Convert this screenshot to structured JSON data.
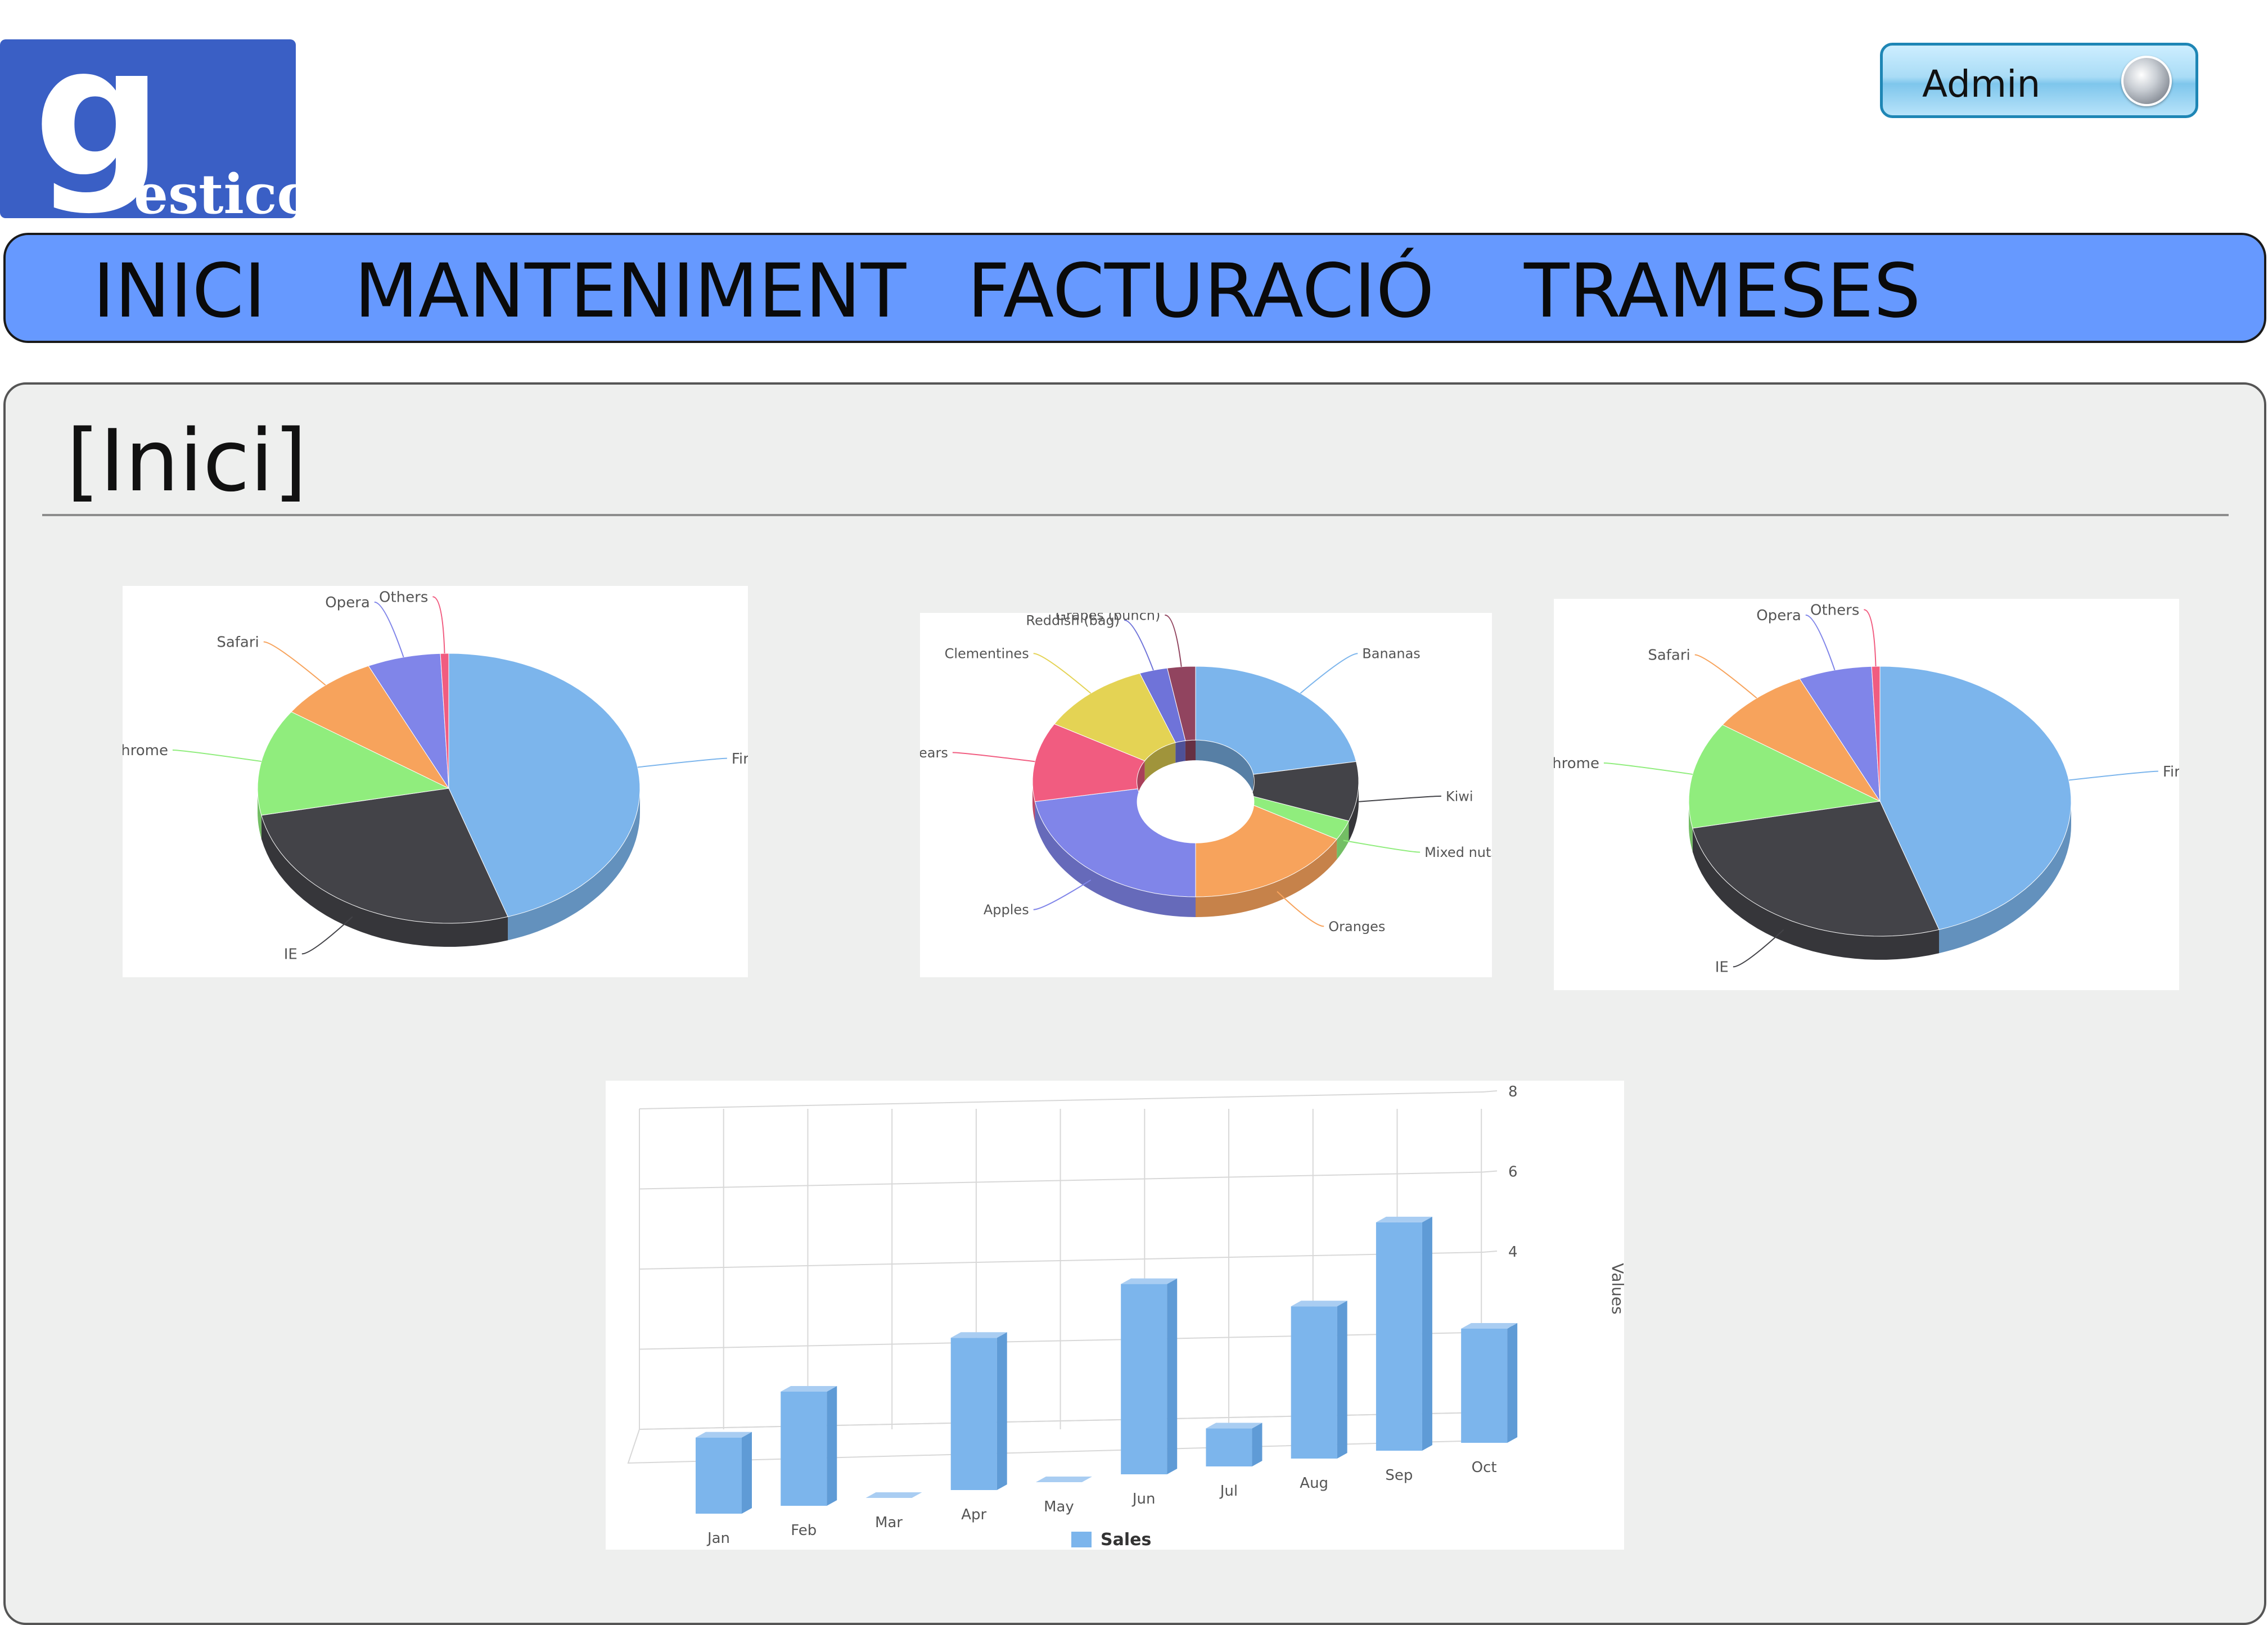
{
  "logo": {
    "big_letter": "g",
    "rest": "esticc"
  },
  "user_button": {
    "label": "Admin"
  },
  "nav": {
    "items": [
      "INICI",
      "MANTENIMENT",
      "FACTURACIÓ",
      "TRAMESES"
    ]
  },
  "page": {
    "title": "[Inici]"
  },
  "colors": {
    "nav_bg": "#6699ff",
    "logo_bg": "#3a5fc5",
    "panel_bg": "#eeefee",
    "series_blue": "#7cb5ec"
  },
  "chart_data": [
    {
      "type": "pie",
      "slices": [
        {
          "label": "Firefox",
          "value": 45.0,
          "color": "#7cb5ec"
        },
        {
          "label": "IE",
          "value": 26.8,
          "color": "#434348"
        },
        {
          "label": "Chrome",
          "value": 12.8,
          "color": "#90ed7d"
        },
        {
          "label": "Safari",
          "value": 8.5,
          "color": "#f7a35c"
        },
        {
          "label": "Opera",
          "value": 6.2,
          "color": "#8085e9"
        },
        {
          "label": "Others",
          "value": 0.7,
          "color": "#f15c80"
        }
      ]
    },
    {
      "type": "pie",
      "slices": [
        {
          "label": "Bananas",
          "value": 8,
          "color": "#7cb5ec"
        },
        {
          "label": "Kiwi",
          "value": 3,
          "color": "#434348"
        },
        {
          "label": "Mixed nuts",
          "value": 1,
          "color": "#90ed7d"
        },
        {
          "label": "Oranges",
          "value": 6,
          "color": "#f7a35c"
        },
        {
          "label": "Apples",
          "value": 8,
          "color": "#8085e9"
        },
        {
          "label": "Pears",
          "value": 4,
          "color": "#f15c80"
        },
        {
          "label": "Clementines",
          "value": 4,
          "color": "#e4d354"
        },
        {
          "label": "Reddish (bag)",
          "value": 1,
          "color": "#6f73d9"
        },
        {
          "label": "Grapes (bunch)",
          "value": 1,
          "color": "#91445f"
        }
      ]
    },
    {
      "type": "pie",
      "slices": [
        {
          "label": "Firefox",
          "value": 45.0,
          "color": "#7cb5ec"
        },
        {
          "label": "IE",
          "value": 26.8,
          "color": "#434348"
        },
        {
          "label": "Chrome",
          "value": 12.8,
          "color": "#90ed7d"
        },
        {
          "label": "Safari",
          "value": 8.5,
          "color": "#f7a35c"
        },
        {
          "label": "Opera",
          "value": 6.2,
          "color": "#8085e9"
        },
        {
          "label": "Others",
          "value": 0.7,
          "color": "#f15c80"
        }
      ]
    },
    {
      "type": "bar",
      "categories": [
        "Jan",
        "Feb",
        "Mar",
        "Apr",
        "May",
        "Jun",
        "Jul",
        "Aug",
        "Sep",
        "Oct"
      ],
      "series": [
        {
          "name": "Sales",
          "values": [
            2,
            3,
            0,
            4,
            0,
            5,
            1,
            4,
            6,
            3
          ]
        }
      ],
      "ylabel": "Values",
      "ylim": [
        0,
        8
      ],
      "yticks": [
        "0",
        "2",
        "4",
        "6",
        "8"
      ],
      "grid": true,
      "legend": "bottom-center"
    }
  ]
}
